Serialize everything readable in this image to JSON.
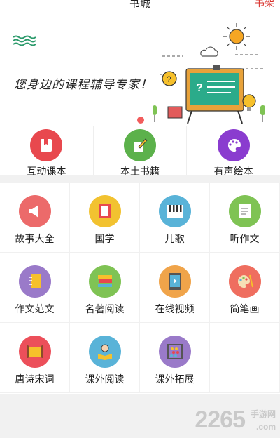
{
  "header": {
    "title": "书城",
    "shelf_label": "书架"
  },
  "banner": {
    "slogan": "您身边的课程辅导专家！"
  },
  "primary": [
    {
      "label": "互动课本",
      "color": "#e8484e",
      "icon": "bookmark-book-icon"
    },
    {
      "label": "本土书籍",
      "color": "#5cb14b",
      "icon": "pen-paper-icon"
    },
    {
      "label": "有声绘本",
      "color": "#8a3ccf",
      "icon": "palette-icon"
    }
  ],
  "grid": [
    {
      "label": "故事大全",
      "color": "#ec6a6a",
      "icon": "megaphone-icon"
    },
    {
      "label": "国学",
      "color": "#f2c230",
      "icon": "book-icon"
    },
    {
      "label": "儿歌",
      "color": "#59b3d8",
      "icon": "piano-icon"
    },
    {
      "label": "听作文",
      "color": "#7fc354",
      "icon": "document-icon"
    },
    {
      "label": "作文范文",
      "color": "#9a7ac9",
      "icon": "notebook-icon"
    },
    {
      "label": "名著阅读",
      "color": "#7fc354",
      "icon": "book-stack-icon"
    },
    {
      "label": "在线视频",
      "color": "#f0a44a",
      "icon": "tablet-play-icon"
    },
    {
      "label": "简笔画",
      "color": "#ef6e5f",
      "icon": "paint-palette-icon"
    },
    {
      "label": "唐诗宋词",
      "color": "#ec4f5a",
      "icon": "scroll-icon"
    },
    {
      "label": "课外阅读",
      "color": "#59b3d8",
      "icon": "reading-kid-icon"
    },
    {
      "label": "课外拓展",
      "color": "#9a7ac9",
      "icon": "abacus-icon"
    }
  ],
  "watermark": {
    "brand": "2265",
    "suffix_top": "手游网",
    "suffix_bottom": ".com"
  }
}
